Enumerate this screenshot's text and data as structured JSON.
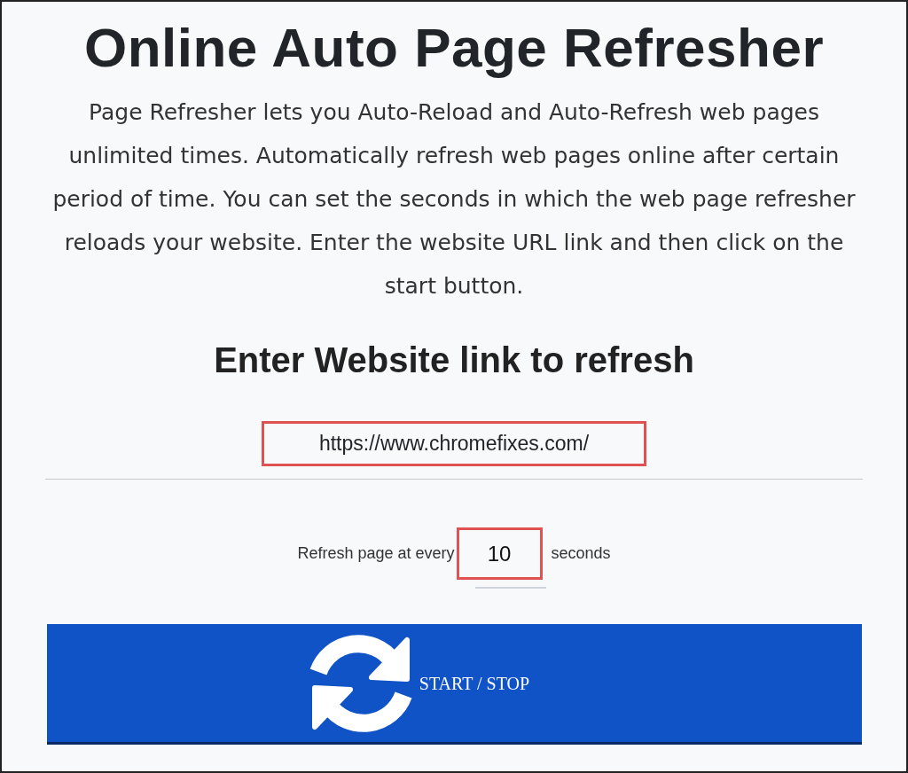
{
  "title": "Online Auto Page Refresher",
  "description": "Page Refresher lets you Auto-Reload and Auto-Refresh web pages unlimited times. Automatically refresh web pages online after certain period of time. You can set the seconds in which the web page refresher reloads your website. Enter the website URL link and then click on the start button.",
  "form_heading": "Enter Website link to refresh",
  "url_field": {
    "value": "https://www.chromefixes.com/"
  },
  "interval": {
    "label_before": "Refresh page at every",
    "value": "10",
    "label_after": "seconds"
  },
  "start_button": {
    "label": "START / STOP"
  }
}
